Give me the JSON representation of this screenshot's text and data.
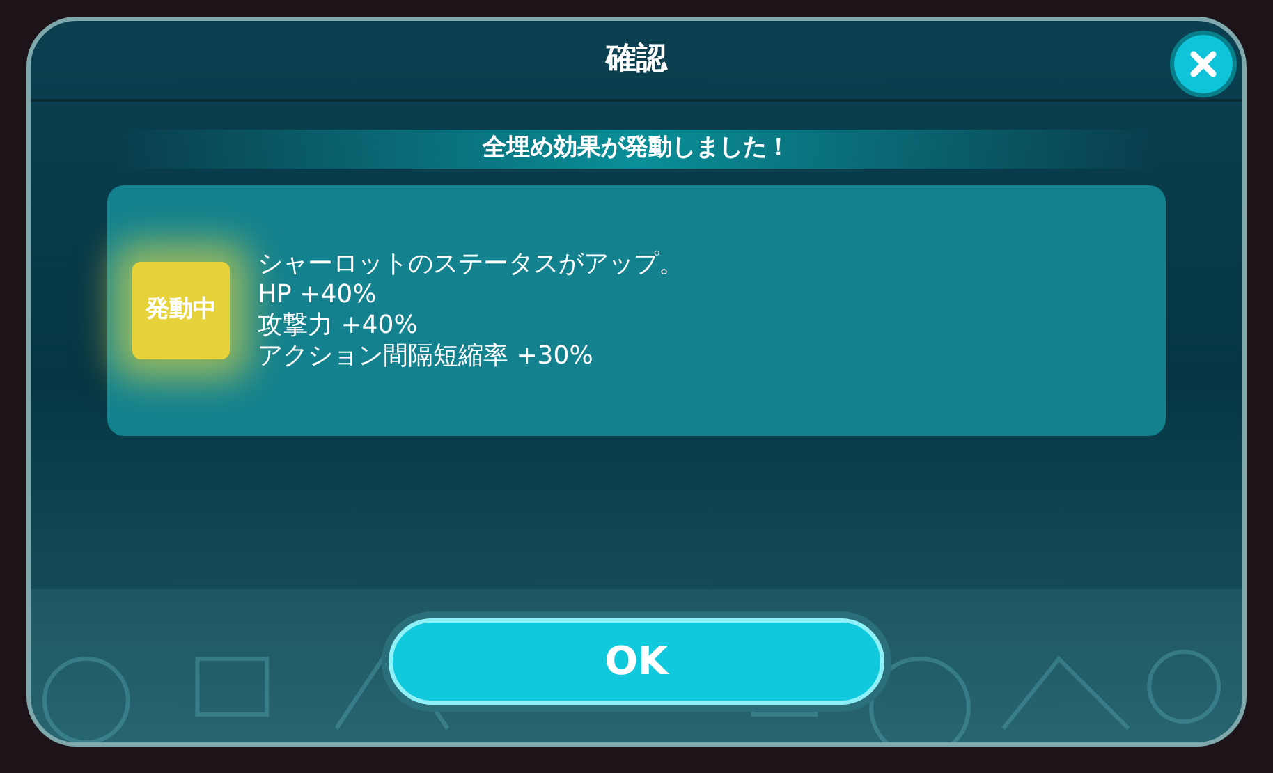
{
  "dialog": {
    "title": "確認",
    "banner": "全埋め効果が発動しました！",
    "effect": {
      "badge": "発動中",
      "active": true,
      "lines": [
        "シャーロットのステータスがアップ。",
        "HP +40%",
        "攻撃力 +40%",
        "アクション間隔短縮率 +30%"
      ]
    },
    "ok_button": "OK"
  }
}
